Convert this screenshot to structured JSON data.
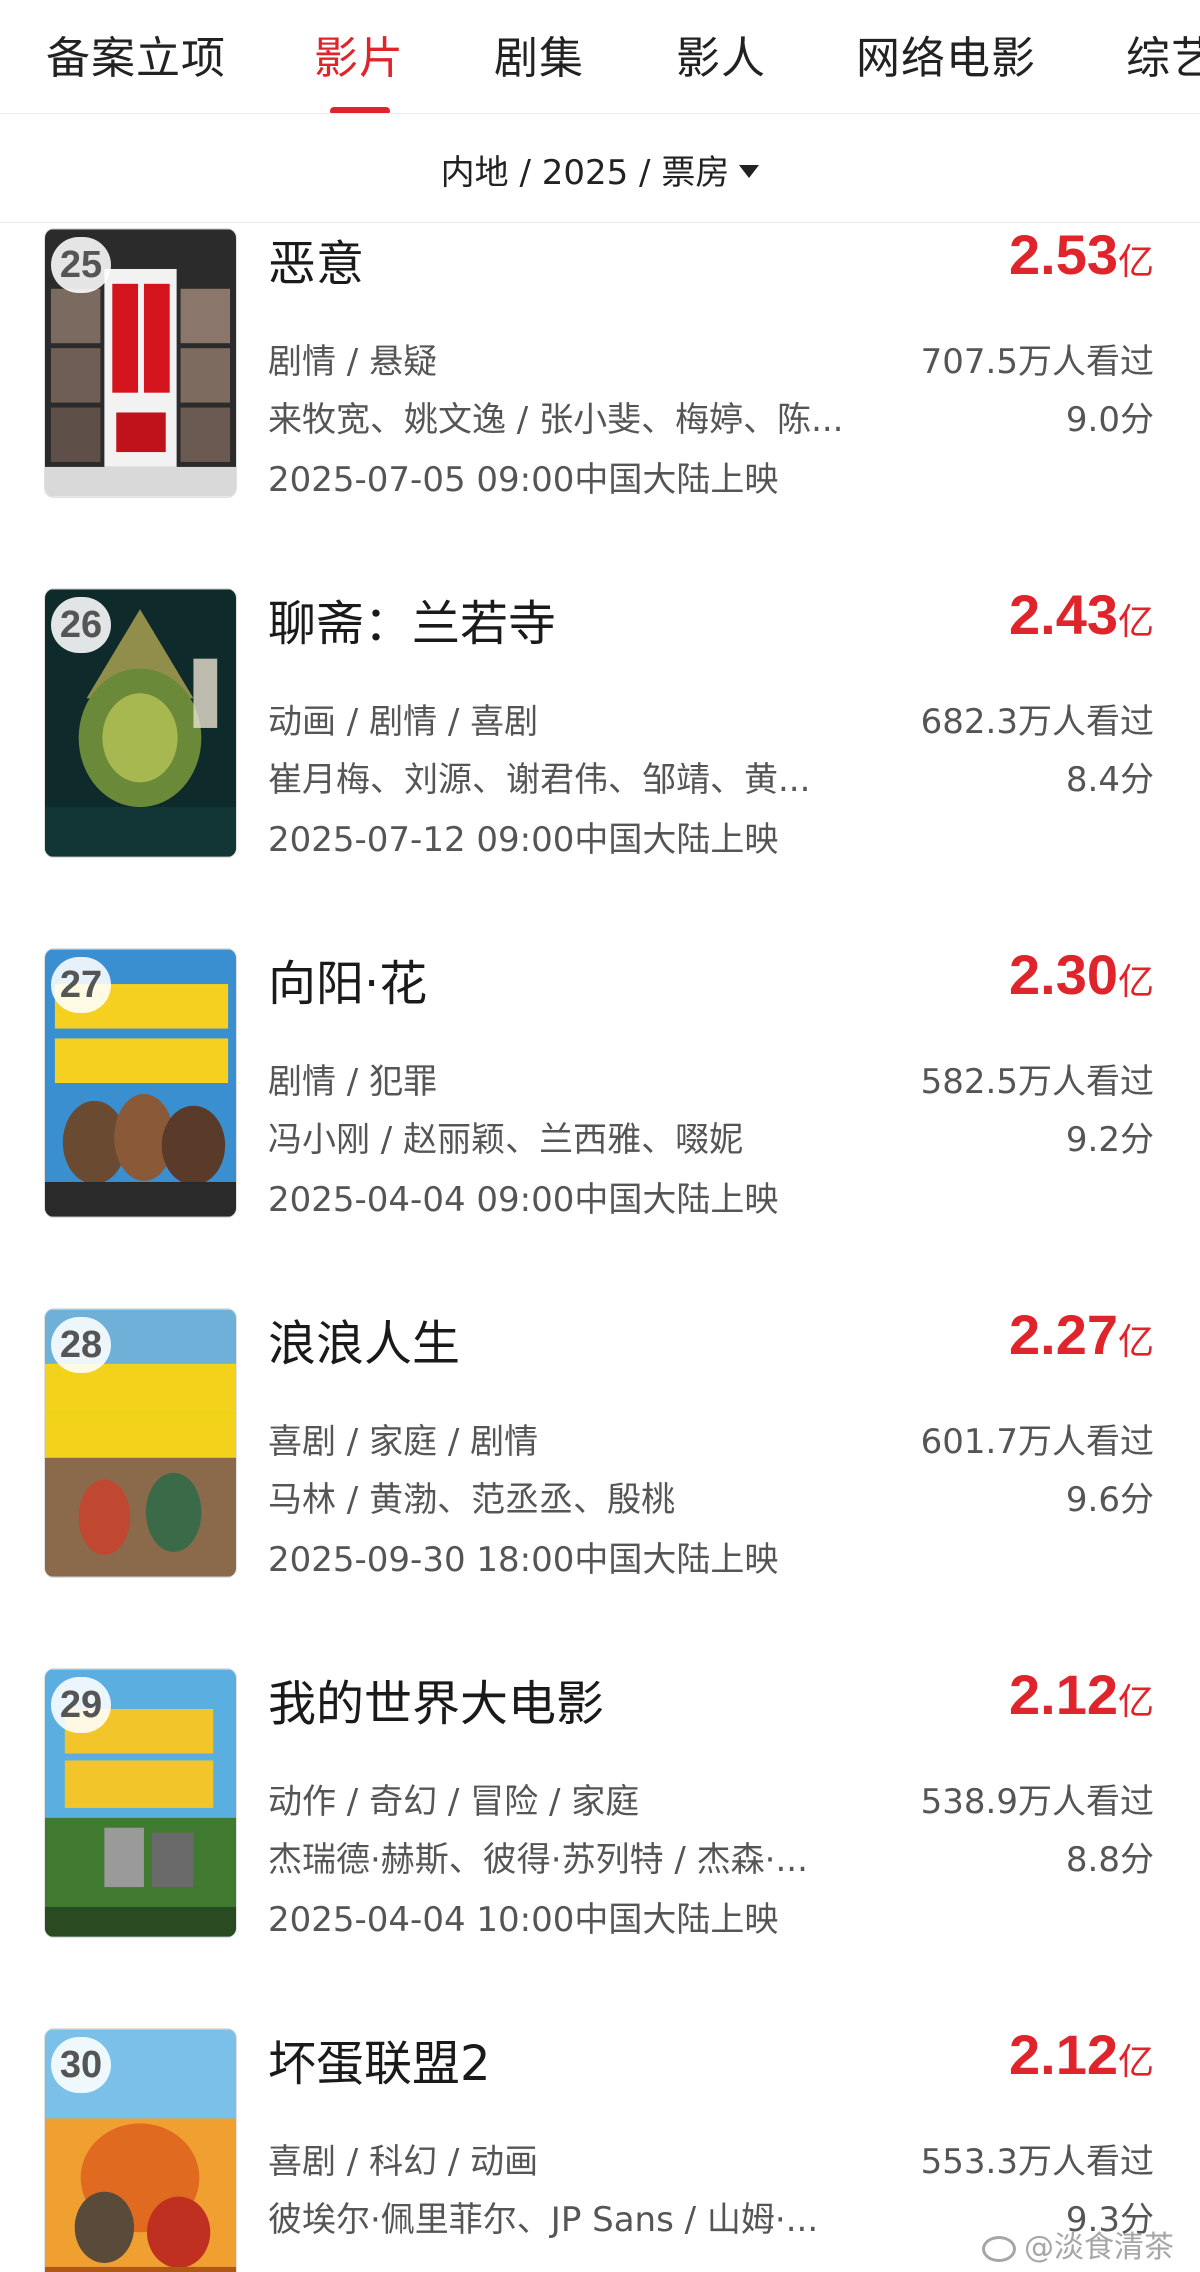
{
  "tabs": [
    {
      "label": "备案立项"
    },
    {
      "label": "影片"
    },
    {
      "label": "剧集"
    },
    {
      "label": "影人"
    },
    {
      "label": "网络电影"
    },
    {
      "label": "综艺"
    }
  ],
  "filter": {
    "label": "内地 / 2025 / 票房"
  },
  "colors": {
    "accent": "#e0242b"
  },
  "movies": [
    {
      "rank": "25",
      "title": "恶意",
      "box_num": "2.53",
      "box_unit": "亿",
      "genre": "剧情 / 悬疑",
      "viewers": "707.5万人看过",
      "cast": "来牧宽、姚文逸 / 张小斐、梅婷、陈...",
      "score": "9.0分",
      "release": "2025-07-05 09:00中国大陆上映"
    },
    {
      "rank": "26",
      "title": "聊斋：兰若寺",
      "box_num": "2.43",
      "box_unit": "亿",
      "genre": "动画 / 剧情 / 喜剧",
      "viewers": "682.3万人看过",
      "cast": "崔月梅、刘源、谢君伟、邹靖、黄...",
      "score": "8.4分",
      "release": "2025-07-12 09:00中国大陆上映"
    },
    {
      "rank": "27",
      "title": "向阳·花",
      "box_num": "2.30",
      "box_unit": "亿",
      "genre": "剧情 / 犯罪",
      "viewers": "582.5万人看过",
      "cast": "冯小刚 / 赵丽颖、兰西雅、啜妮",
      "score": "9.2分",
      "release": "2025-04-04 09:00中国大陆上映"
    },
    {
      "rank": "28",
      "title": "浪浪人生",
      "box_num": "2.27",
      "box_unit": "亿",
      "genre": "喜剧 / 家庭 / 剧情",
      "viewers": "601.7万人看过",
      "cast": "马林 / 黄渤、范丞丞、殷桃",
      "score": "9.6分",
      "release": "2025-09-30 18:00中国大陆上映"
    },
    {
      "rank": "29",
      "title": "我的世界大电影",
      "box_num": "2.12",
      "box_unit": "亿",
      "genre": "动作 / 奇幻 / 冒险 / 家庭",
      "viewers": "538.9万人看过",
      "cast": "杰瑞德·赫斯、彼得·苏列特 / 杰森·...",
      "score": "8.8分",
      "release": "2025-04-04 10:00中国大陆上映"
    },
    {
      "rank": "30",
      "title": "坏蛋联盟2",
      "box_num": "2.12",
      "box_unit": "亿",
      "genre": "喜剧 / 科幻 / 动画",
      "viewers": "553.3万人看过",
      "cast": "彼埃尔·佩里菲尔、JP Sans / 山姆·...",
      "score": "9.3分",
      "release": ""
    }
  ],
  "watermark": {
    "label": "@淡食清茶"
  }
}
